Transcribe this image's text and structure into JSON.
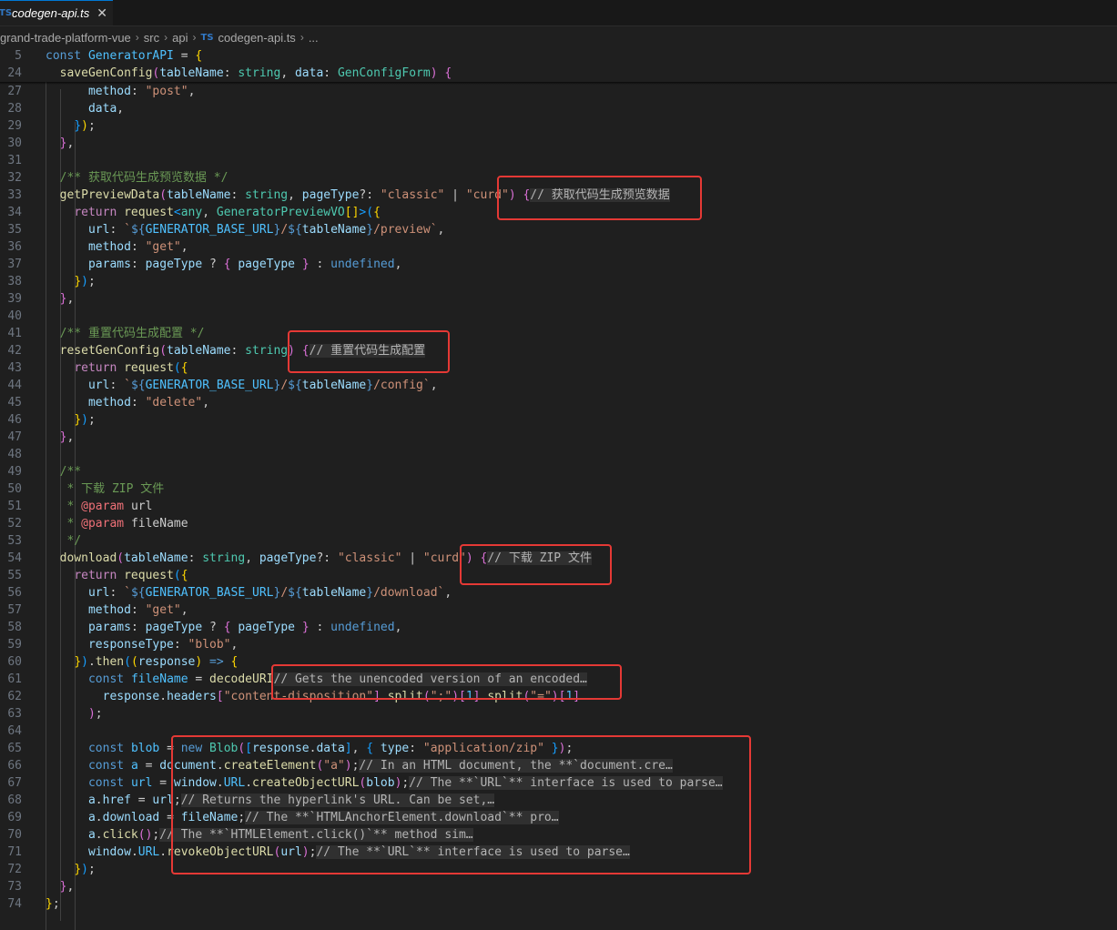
{
  "tab": {
    "icon": "TS",
    "label": "codegen-api.ts",
    "close": "✕"
  },
  "breadcrumb": {
    "parts": [
      "grand-trade-platform-vue",
      "src",
      "api"
    ],
    "ts_icon": "TS",
    "file": "codegen-api.ts",
    "more": "..."
  },
  "lines": [
    {
      "n": "5",
      "html": "<span class='k'>const</span> <span class='cv'>GeneratorAPI</span> = <span class='b1'>{</span>"
    },
    {
      "n": "24",
      "html": "  <span class='f'>saveGenConfig</span><span class='b2'>(</span><span class='v'>tableName</span>: <span class='t'>string</span>, <span class='v'>data</span>: <span class='t'>GenConfigForm</span><span class='b2'>)</span> <span class='b2'>{</span>"
    },
    {
      "n": "27",
      "html": "      <span class='v'>method</span>: <span class='s'>\"post\"</span>,"
    },
    {
      "n": "28",
      "html": "      <span class='v'>data</span>,"
    },
    {
      "n": "29",
      "html": "    <span class='b3'>}</span><span class='b1'>)</span>;"
    },
    {
      "n": "30",
      "html": "  <span class='b2'>}</span>,"
    },
    {
      "n": "31",
      "html": ""
    },
    {
      "n": "32",
      "html": "  <span class='cm'>/** 获取代码生成预览数据 */</span>"
    },
    {
      "n": "33",
      "html": "  <span class='f'>getPreviewData</span><span class='b2'>(</span><span class='v'>tableName</span>: <span class='t'>string</span>, <span class='v'>pageType</span>?: <span class='s'>\"classic\"</span> | <span class='s'>\"curd\"</span><span class='b2'>)</span> <span class='b2'>{</span><span class='hint'>// 获取代码生成预览数据</span>"
    },
    {
      "n": "34",
      "html": "    <span class='c'>return</span> <span class='f'>request</span><span class='b3'>&lt;</span><span class='t'>any</span>, <span class='t'>GeneratorPreviewVO</span><span class='b1'>[]</span><span class='b3'>&gt;</span><span class='b3'>(</span><span class='b1'>{</span>"
    },
    {
      "n": "35",
      "html": "      <span class='v'>url</span>: <span class='s'>`</span><span class='k'>${</span><span class='cv'>GENERATOR_BASE_URL</span><span class='k'>}</span><span class='s'>/</span><span class='k'>${</span><span class='v'>tableName</span><span class='k'>}</span><span class='s'>/preview`</span>,"
    },
    {
      "n": "36",
      "html": "      <span class='v'>method</span>: <span class='s'>\"get\"</span>,"
    },
    {
      "n": "37",
      "html": "      <span class='v'>params</span>: <span class='v'>pageType</span> ? <span class='b2'>{</span> <span class='v'>pageType</span> <span class='b2'>}</span> : <span class='k'>undefined</span>,"
    },
    {
      "n": "38",
      "html": "    <span class='b1'>}</span><span class='b3'>)</span>;"
    },
    {
      "n": "39",
      "html": "  <span class='b2'>}</span>,"
    },
    {
      "n": "40",
      "html": ""
    },
    {
      "n": "41",
      "html": "  <span class='cm'>/** 重置代码生成配置 */</span>"
    },
    {
      "n": "42",
      "html": "  <span class='f'>resetGenConfig</span><span class='b2'>(</span><span class='v'>tableName</span>: <span class='t'>string</span><span class='b2'>)</span> <span class='b2'>{</span><span class='hint'>// 重置代码生成配置</span>"
    },
    {
      "n": "43",
      "html": "    <span class='c'>return</span> <span class='f'>request</span><span class='b3'>(</span><span class='b1'>{</span>"
    },
    {
      "n": "44",
      "html": "      <span class='v'>url</span>: <span class='s'>`</span><span class='k'>${</span><span class='cv'>GENERATOR_BASE_URL</span><span class='k'>}</span><span class='s'>/</span><span class='k'>${</span><span class='v'>tableName</span><span class='k'>}</span><span class='s'>/config`</span>,"
    },
    {
      "n": "45",
      "html": "      <span class='v'>method</span>: <span class='s'>\"delete\"</span>,"
    },
    {
      "n": "46",
      "html": "    <span class='b1'>}</span><span class='b3'>)</span>;"
    },
    {
      "n": "47",
      "html": "  <span class='b2'>}</span>,"
    },
    {
      "n": "48",
      "html": ""
    },
    {
      "n": "49",
      "html": "  <span class='cm'>/**</span>"
    },
    {
      "n": "50",
      "html": "  <span class='cm'> * 下载 ZIP 文件</span>"
    },
    {
      "n": "51",
      "html": "  <span class='cm'> * </span><span class='c' style='color:#f07178'>@param</span> <span class='p'>url</span>"
    },
    {
      "n": "52",
      "html": "  <span class='cm'> * </span><span class='c' style='color:#f07178'>@param</span> <span class='p'>fileName</span>"
    },
    {
      "n": "53",
      "html": "  <span class='cm'> */</span>"
    },
    {
      "n": "54",
      "html": "  <span class='f'>download</span><span class='b2'>(</span><span class='v'>tableName</span>: <span class='t'>string</span>, <span class='v'>pageType</span>?: <span class='s'>\"classic\"</span> | <span class='s'>\"curd\"</span><span class='b2'>)</span> <span class='b2'>{</span><span class='hint'>// 下载 ZIP 文件</span>"
    },
    {
      "n": "55",
      "html": "    <span class='c'>return</span> <span class='f'>request</span><span class='b3'>(</span><span class='b1'>{</span>"
    },
    {
      "n": "56",
      "html": "      <span class='v'>url</span>: <span class='s'>`</span><span class='k'>${</span><span class='cv'>GENERATOR_BASE_URL</span><span class='k'>}</span><span class='s'>/</span><span class='k'>${</span><span class='v'>tableName</span><span class='k'>}</span><span class='s'>/download`</span>,"
    },
    {
      "n": "57",
      "html": "      <span class='v'>method</span>: <span class='s'>\"get\"</span>,"
    },
    {
      "n": "58",
      "html": "      <span class='v'>params</span>: <span class='v'>pageType</span> ? <span class='b2'>{</span> <span class='v'>pageType</span> <span class='b2'>}</span> : <span class='k'>undefined</span>,"
    },
    {
      "n": "59",
      "html": "      <span class='v'>responseType</span>: <span class='s'>\"blob\"</span>,"
    },
    {
      "n": "60",
      "html": "    <span class='b1'>}</span><span class='b3'>)</span>.<span class='f'>then</span><span class='b3'>(</span><span class='b1'>(</span><span class='v'>response</span><span class='b1'>)</span> <span class='k'>=&gt;</span> <span class='b1'>{</span>"
    },
    {
      "n": "61",
      "html": "      <span class='k'>const</span> <span class='cv'>fileName</span> = <span class='f'>decodeURI</span><span class='hint'>// Gets the unencoded version of an encoded…</span>"
    },
    {
      "n": "62",
      "html": "        <span class='v'>response</span>.<span class='v'>headers</span><span class='b2'>[</span><span class='s'>\"content-disposition\"</span><span class='b2'>]</span>.<span class='f'>split</span><span class='b2'>(</span><span class='s'>\";\"</span><span class='b2'>)</span><span class='b2'>[</span><span class='cv'>1</span><span class='b2'>]</span>.<span class='f'>split</span><span class='b2'>(</span><span class='s'>\"=\"</span><span class='b2'>)</span><span class='b2'>[</span><span class='cv'>1</span><span class='b2'>]</span>"
    },
    {
      "n": "63",
      "html": "      <span class='b2'>)</span>;"
    },
    {
      "n": "64",
      "html": ""
    },
    {
      "n": "65",
      "html": "      <span class='k'>const</span> <span class='cv'>blob</span> = <span class='k'>new</span> <span class='t'>Blob</span><span class='b2'>(</span><span class='b3'>[</span><span class='v'>response</span>.<span class='v'>data</span><span class='b3'>]</span>, <span class='b3'>{</span> <span class='v'>type</span>: <span class='s'>\"application/zip\"</span> <span class='b3'>}</span><span class='b2'>)</span>;"
    },
    {
      "n": "66",
      "html": "      <span class='k'>const</span> <span class='cv'>a</span> = <span class='v'>document</span>.<span class='f'>createElement</span><span class='b2'>(</span><span class='s'>\"a\"</span><span class='b2'>)</span>;<span class='hint'>// In an HTML document, the **`document.cre…</span>"
    },
    {
      "n": "67",
      "html": "      <span class='k'>const</span> <span class='cv'>url</span> = <span class='v'>window</span>.<span class='cv'>URL</span>.<span class='f'>createObjectURL</span><span class='b2'>(</span><span class='v'>blob</span><span class='b2'>)</span>;<span class='hint'>// The **`URL`** interface is used to parse…</span>"
    },
    {
      "n": "68",
      "html": "      <span class='v'>a</span>.<span class='v'>href</span> = <span class='v'>url</span>;<span class='hint'>// Returns the hyperlink's URL. Can be set,…</span>"
    },
    {
      "n": "69",
      "html": "      <span class='v'>a</span>.<span class='v'>download</span> = <span class='v'>fileName</span>;<span class='hint'>// The **`HTMLAnchorElement.download`** pro…</span>"
    },
    {
      "n": "70",
      "html": "      <span class='v'>a</span>.<span class='f'>click</span><span class='b2'>()</span>;<span class='hint'>// The **`HTMLElement.click()`** method sim…</span>"
    },
    {
      "n": "71",
      "html": "      <span class='v'>window</span>.<span class='cv'>URL</span>.<span class='f'>revokeObjectURL</span><span class='b2'>(</span><span class='v'>url</span><span class='b2'>)</span>;<span class='hint'>// The **`URL`** interface is used to parse…</span>"
    },
    {
      "n": "72",
      "html": "    <span class='b1'>}</span><span class='b3'>)</span>;"
    },
    {
      "n": "73",
      "html": "  <span class='b2'>}</span>,"
    },
    {
      "n": "74",
      "html": "<span class='b1'>}</span>;"
    }
  ],
  "annotation_color": "#e53935"
}
